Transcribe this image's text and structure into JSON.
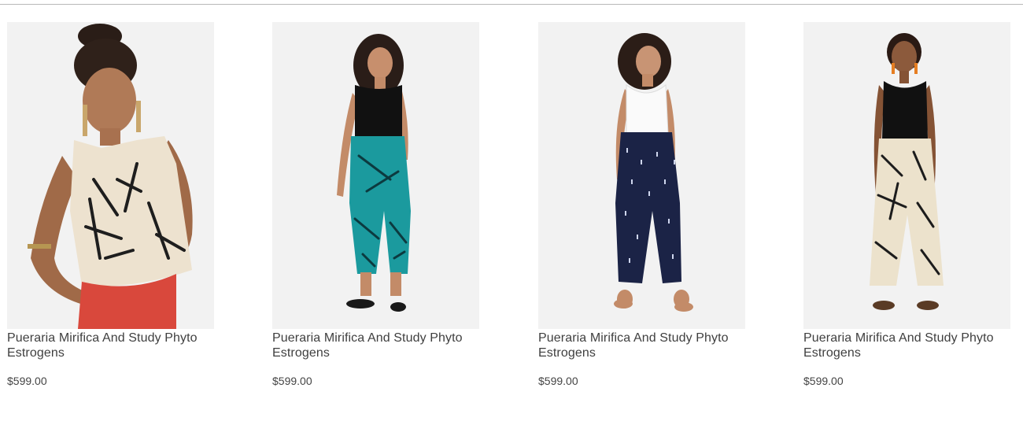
{
  "products": [
    {
      "name": "Pueraria Mirifica And Study Phyto Estrogens",
      "price": "$599.00",
      "image": "model-cropped-top-red-skirt"
    },
    {
      "name": "Pueraria Mirifica And Study Phyto Estrogens",
      "price": "$599.00",
      "image": "model-teal-wrap-pants"
    },
    {
      "name": "Pueraria Mirifica And Study Phyto Estrogens",
      "price": "$599.00",
      "image": "model-navy-wrap-pants"
    },
    {
      "name": "Pueraria Mirifica And Study Phyto Estrogens",
      "price": "$599.00",
      "image": "model-cream-wide-pants"
    }
  ],
  "colors": {
    "image_background": "#f2f2f2",
    "divider": "#b9b9b9",
    "text": "#3f3f3f"
  }
}
